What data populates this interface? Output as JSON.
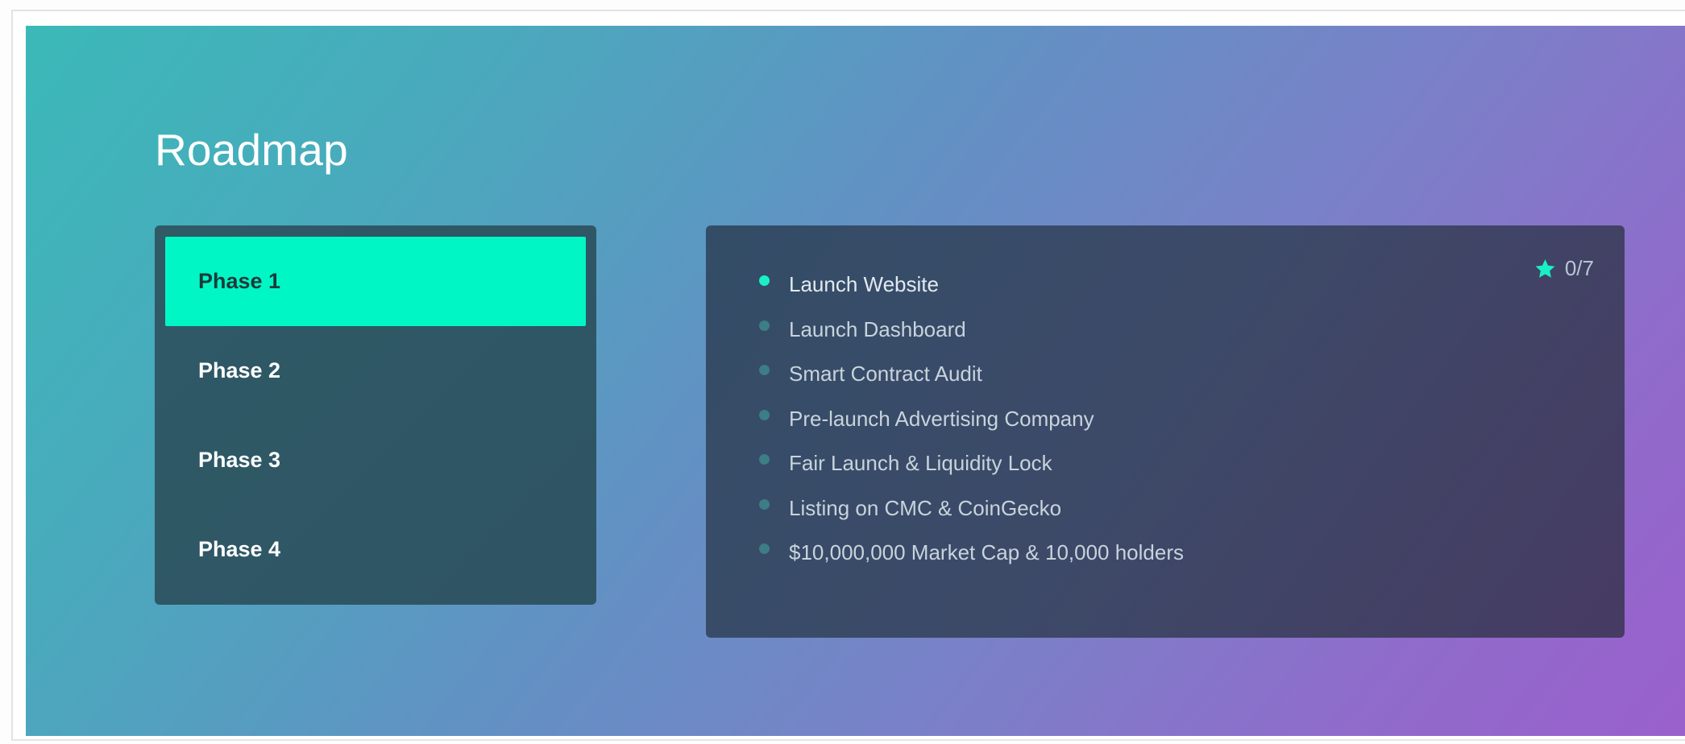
{
  "section": {
    "title": "Roadmap"
  },
  "phases": [
    {
      "label": "Phase 1",
      "active": true
    },
    {
      "label": "Phase 2",
      "active": false
    },
    {
      "label": "Phase 3",
      "active": false
    },
    {
      "label": "Phase 4",
      "active": false
    }
  ],
  "phase_details": {
    "progress": "0/7",
    "goals": [
      {
        "text": "Launch Website",
        "completed": true
      },
      {
        "text": "Launch Dashboard",
        "completed": false
      },
      {
        "text": "Smart Contract Audit",
        "completed": false
      },
      {
        "text": "Pre-launch Advertising Company",
        "completed": false
      },
      {
        "text": "Fair Launch & Liquidity Lock",
        "completed": false
      },
      {
        "text": "Listing on CMC & CoinGecko",
        "completed": false
      },
      {
        "text": "$10,000,000 Market Cap & 10,000 holders",
        "completed": false
      }
    ]
  },
  "icons": {
    "progress": "star-icon",
    "goal_bullet": "bullet-dot-icon"
  },
  "colors": {
    "accent": "#00f7c5",
    "panel": "#2f5a66",
    "details_panel": "#3c4a68",
    "gradient_start": "#3bb9b8",
    "gradient_end": "#9a60cc"
  }
}
